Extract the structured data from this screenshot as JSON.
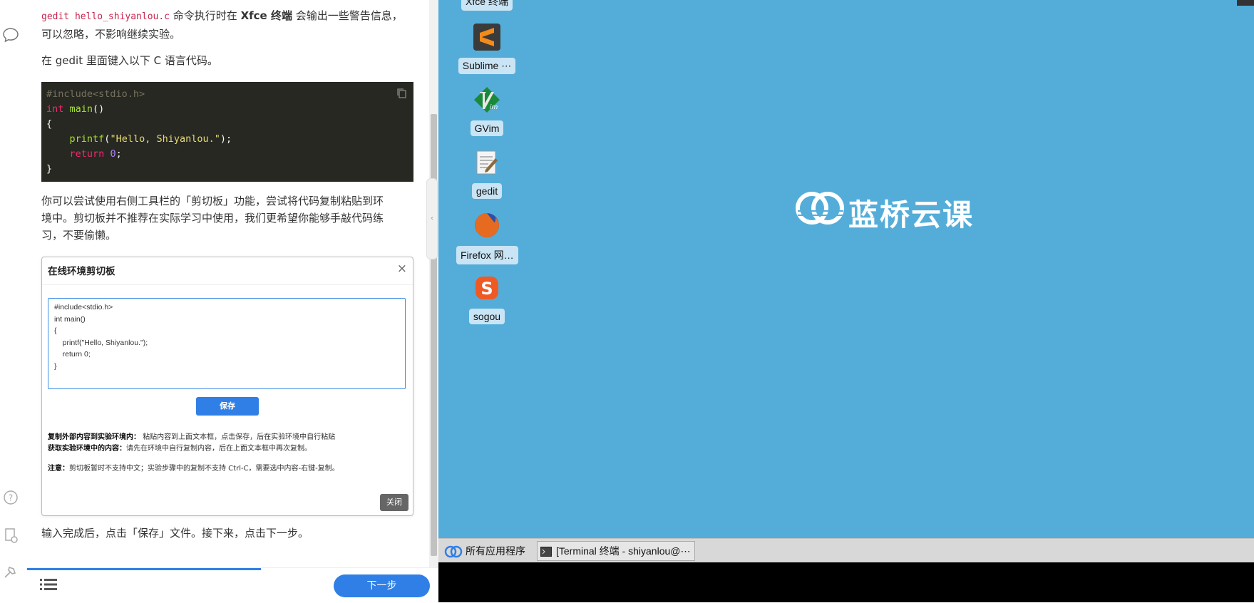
{
  "doc": {
    "intro_code": "gedit hello_shiyanlou.c",
    "intro_text_1": " 命令执行时在 ",
    "intro_bold": "Xfce 终端",
    "intro_text_2": " 会输出一些警告信息，",
    "intro_line2": "可以忽略，不影响继续实验。",
    "para_gedit": "在 gedit 里面键入以下 C 语言代码。",
    "code": {
      "l1": "#include<stdio.h>",
      "l2_kw": "int",
      "l2_fn": "main",
      "l2_rest": "()",
      "l3": "{",
      "l4_fn": "printf",
      "l4_str": "\"Hello, Shiyanlou.\"",
      "l4_rest": ");",
      "l5_kw": "return",
      "l5_num": "0",
      "l5_rest": ";",
      "l6": "}"
    },
    "para_clip_1": "你可以尝试使用右侧工具栏的「剪切板」功能，尝试将代码复制粘贴到环",
    "para_clip_2": "境中。剪切板并不推荐在实际学习中使用，我们更希望你能够手敲代码练",
    "para_clip_3": "习，不要偷懒。",
    "para_save": "输入完成后，点击「保存」文件。接下来，点击下一步。"
  },
  "clipboard": {
    "title": "在线环境剪切板",
    "close_x": "×",
    "textarea_value": "#include<stdio.h>\nint main()\n{\n    printf(\"Hello, Shiyanlou.\");\n    return 0;\n}",
    "save_label": "保存",
    "note1_bold": "复制外部内容到实验环境内：",
    "note1_text": " 粘贴内容到上面文本框，点击保存，后在实验环境中自行粘贴",
    "note2_bold": "获取实验环境中的内容：",
    "note2_text": "请先在环境中自行复制内容，后在上面文本框中再次复制。",
    "note3_bold": "注意：",
    "note3_text": "剪切板暂时不支持中文；实验步骤中的复制不支持 Ctrl-C，需要选中内容-右键-复制。",
    "close_label": "关闭"
  },
  "bottom": {
    "next_label": "下一步"
  },
  "desktop": {
    "top_icon_label": "Xfce 终端",
    "icons": [
      {
        "label": "Sublime ⋯",
        "icon": "sublime-icon"
      },
      {
        "label": "GVim",
        "icon": "gvim-icon"
      },
      {
        "label": "gedit",
        "icon": "gedit-icon"
      },
      {
        "label": "Firefox 网…",
        "icon": "firefox-icon"
      },
      {
        "label": "sogou",
        "icon": "sogou-icon"
      }
    ],
    "brand": "蓝桥云课"
  },
  "taskbar": {
    "apps_label": "所有应用程序",
    "task_label": "[Terminal 终端 - shiyanlou@⋯"
  },
  "colors": {
    "accent": "#2f7fe6",
    "desktop_bg": "#54add9",
    "code_bg": "#272822"
  }
}
